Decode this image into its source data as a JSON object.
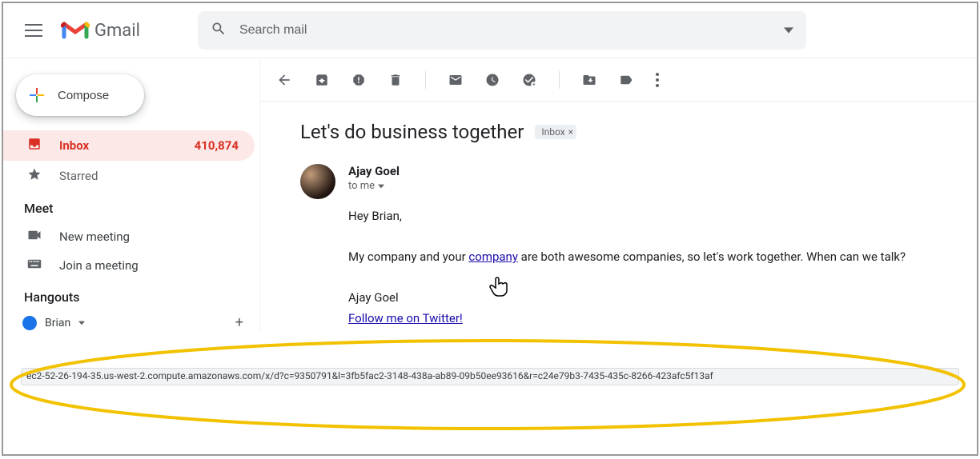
{
  "header": {
    "brand_text": "Gmail",
    "search_placeholder": "Search mail"
  },
  "sidebar": {
    "compose": "Compose",
    "folders": {
      "inbox": {
        "label": "Inbox",
        "count": "410,874"
      },
      "starred": {
        "label": "Starred"
      }
    },
    "meet": {
      "title": "Meet",
      "new_meeting": "New meeting",
      "join_meeting": "Join a meeting"
    },
    "hangouts": {
      "title": "Hangouts",
      "user": "Brian"
    }
  },
  "email": {
    "subject": "Let's do business together",
    "chip": {
      "label": "Inbox",
      "close": "×"
    },
    "sender": {
      "name": "Ajay Goel",
      "to": "to me"
    },
    "body": {
      "greeting": "Hey Brian,",
      "line1_pre": "My company and your ",
      "line1_link": "company",
      "line1_post": " are both awesome companies, so let's work together. When can we talk?",
      "signoff": "Ajay Goel",
      "twitter": "Follow me on Twitter!"
    }
  },
  "status_url": "ec2-52-26-194-35.us-west-2.compute.amazonaws.com/x/d?c=9350791&l=3fb5fac2-3148-438a-ab89-09b50ee93616&r=c24e79b3-7435-435c-8266-423afc5f13af"
}
